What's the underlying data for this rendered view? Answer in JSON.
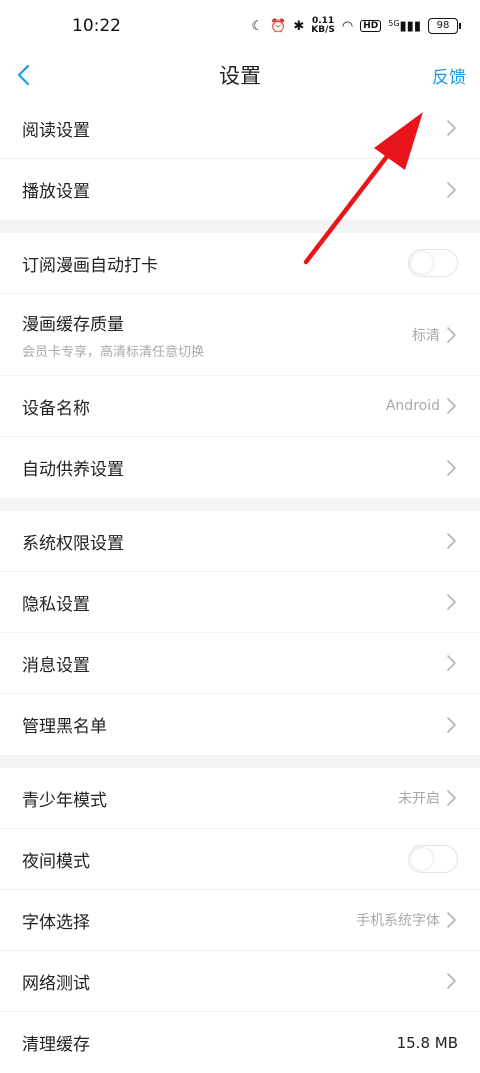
{
  "status": {
    "time": "10:22",
    "net_speed_top": "0.11",
    "net_speed_unit": "KB/S",
    "hd": "HD",
    "signal": "5G",
    "battery": "98"
  },
  "nav": {
    "title": "设置",
    "feedback": "反馈"
  },
  "groups": [
    {
      "rows": [
        {
          "label": "阅读设置"
        },
        {
          "label": "播放设置"
        }
      ]
    },
    {
      "rows": [
        {
          "label": "订阅漫画自动打卡",
          "toggle": false
        },
        {
          "label": "漫画缓存质量",
          "sub": "会员卡专享，高清标清任意切换",
          "value": "标清"
        },
        {
          "label": "设备名称",
          "value": "Android"
        },
        {
          "label": "自动供养设置"
        }
      ]
    },
    {
      "rows": [
        {
          "label": "系统权限设置"
        },
        {
          "label": "隐私设置"
        },
        {
          "label": "消息设置"
        },
        {
          "label": "管理黑名单"
        }
      ]
    },
    {
      "rows": [
        {
          "label": "青少年模式",
          "value": "未开启"
        },
        {
          "label": "夜间模式",
          "toggle": false
        },
        {
          "label": "字体选择",
          "value": "手机系统字体"
        },
        {
          "label": "网络测试"
        },
        {
          "label": "清理缓存",
          "value": "15.8 MB"
        }
      ]
    }
  ],
  "colors": {
    "accent": "#1a9be0",
    "arrow": "#e8161b"
  }
}
